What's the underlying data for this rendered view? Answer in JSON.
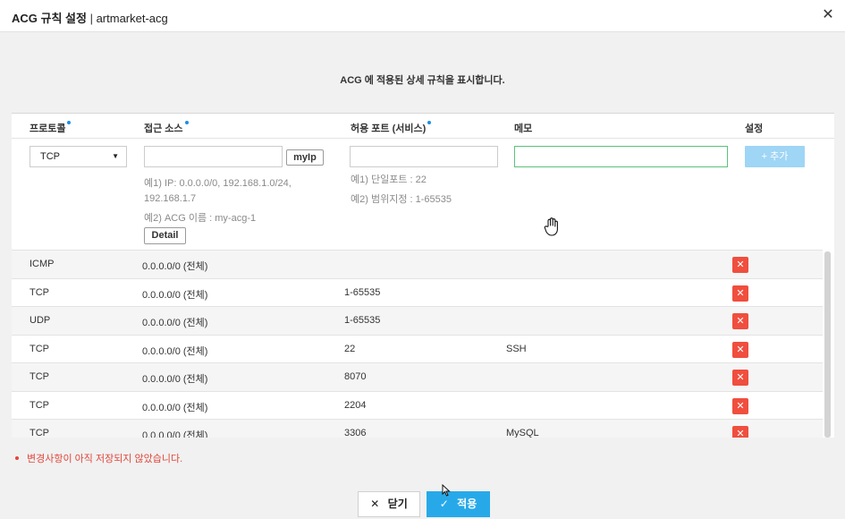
{
  "header": {
    "title_bold": "ACG 규칙 설정",
    "title_sep": " | ",
    "title_name": "artmarket-acg",
    "close_icon": "✕"
  },
  "description": "ACG 에 적용된 상세 규칙을 표시합니다.",
  "columns": {
    "protocol": "프로토콜",
    "source": "접근 소스",
    "port": "허용 포트 (서비스)",
    "memo": "메모",
    "setting": "설정"
  },
  "form": {
    "protocol_value": "TCP",
    "myip_label": "myIp",
    "add_label": "+ 추가",
    "source_hint1": "예1) IP: 0.0.0.0/0, 192.168.1.0/24,",
    "source_hint1b": "192.168.1.7",
    "source_hint2": "예2) ACG 이름 : my-acg-1",
    "detail_label": "Detail",
    "port_hint1": "예1) 단일포트 : 22",
    "port_hint2": "예2) 범위지정 : 1-65535"
  },
  "rules": [
    {
      "protocol": "ICMP",
      "source": "0.0.0.0/0 (전체)",
      "port": "",
      "memo": ""
    },
    {
      "protocol": "TCP",
      "source": "0.0.0.0/0 (전체)",
      "port": "1-65535",
      "memo": ""
    },
    {
      "protocol": "UDP",
      "source": "0.0.0.0/0 (전체)",
      "port": "1-65535",
      "memo": ""
    },
    {
      "protocol": "TCP",
      "source": "0.0.0.0/0 (전체)",
      "port": "22",
      "memo": "SSH"
    },
    {
      "protocol": "TCP",
      "source": "0.0.0.0/0 (전체)",
      "port": "8070",
      "memo": ""
    },
    {
      "protocol": "TCP",
      "source": "0.0.0.0/0 (전체)",
      "port": "2204",
      "memo": ""
    },
    {
      "protocol": "TCP",
      "source": "0.0.0.0/0 (전체)",
      "port": "3306",
      "memo": "MySQL"
    }
  ],
  "delete_icon": "✕",
  "warning": "변경사항이 아직 저장되지 않았습니다.",
  "footer": {
    "close_label": "닫기",
    "close_icon": "✕",
    "apply_label": "적용",
    "apply_icon": "✓"
  },
  "colors": {
    "accent": "#27a9e9",
    "danger": "#f04e3e",
    "add_disabled": "#9fd5f5",
    "focus": "#5bc27a"
  }
}
